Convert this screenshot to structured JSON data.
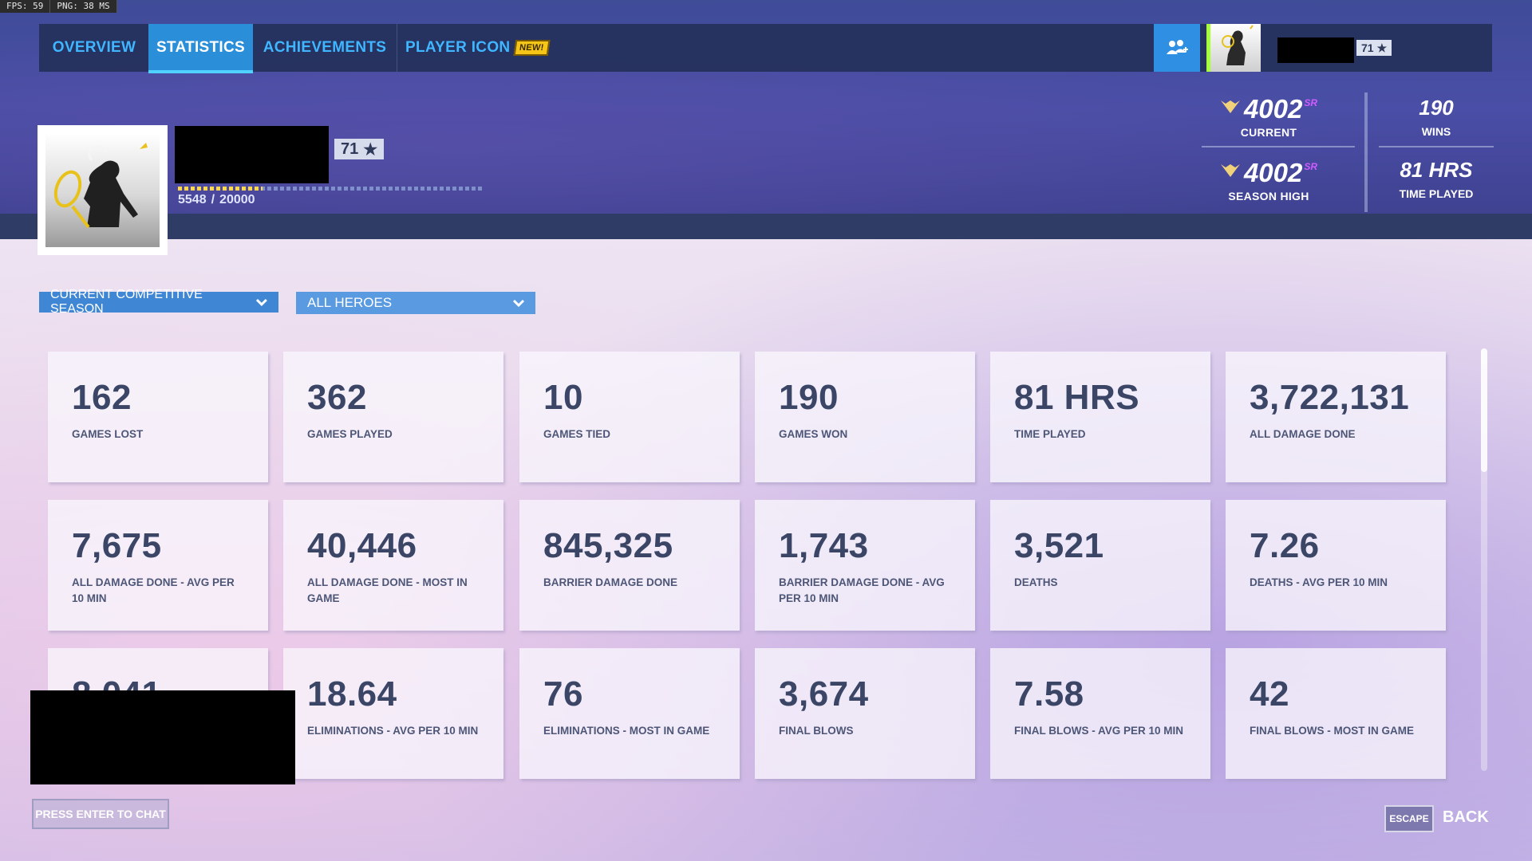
{
  "debug": {
    "fps": "FPS:  59",
    "png": "PNG:  38 MS"
  },
  "nav": {
    "tabs": [
      {
        "label": "OVERVIEW"
      },
      {
        "label": "STATISTICS"
      },
      {
        "label": "ACHIEVEMENTS"
      },
      {
        "label": "PLAYER ICON"
      }
    ],
    "new_badge": "NEW!",
    "player_level": "71"
  },
  "profile": {
    "level": "71",
    "xp_current": "5548",
    "xp_total": "20000",
    "xp_fraction": 0.277
  },
  "rank": {
    "current_sr": "4002",
    "current_label": "CURRENT",
    "season_high_sr": "4002",
    "season_high_label": "SEASON HIGH",
    "sr_suffix": "SR",
    "wins": "190",
    "wins_label": "WINS",
    "time_played": "81 HRS",
    "time_played_label": "TIME PLAYED"
  },
  "filters": {
    "season": "CURRENT COMPETITIVE SEASON",
    "hero": "ALL HEROES"
  },
  "stats": [
    {
      "value": "162",
      "label": "GAMES LOST"
    },
    {
      "value": "362",
      "label": "GAMES PLAYED"
    },
    {
      "value": "10",
      "label": "GAMES TIED"
    },
    {
      "value": "190",
      "label": "GAMES WON"
    },
    {
      "value": "81 HRS",
      "label": "TIME PLAYED"
    },
    {
      "value": "3,722,131",
      "label": "ALL DAMAGE DONE"
    },
    {
      "value": "7,675",
      "label": "ALL DAMAGE DONE - AVG PER 10 MIN"
    },
    {
      "value": "40,446",
      "label": "ALL DAMAGE DONE - MOST IN GAME"
    },
    {
      "value": "845,325",
      "label": "BARRIER DAMAGE DONE"
    },
    {
      "value": "1,743",
      "label": "BARRIER DAMAGE DONE - AVG PER 10 MIN"
    },
    {
      "value": "3,521",
      "label": "DEATHS"
    },
    {
      "value": "7.26",
      "label": "DEATHS - AVG PER 10 MIN"
    },
    {
      "value": "8,041",
      "label": ""
    },
    {
      "value": "18.64",
      "label": "ELIMINATIONS - AVG PER 10 MIN"
    },
    {
      "value": "76",
      "label": "ELIMINATIONS - MOST IN GAME"
    },
    {
      "value": "3,674",
      "label": "FINAL BLOWS"
    },
    {
      "value": "7.58",
      "label": "FINAL BLOWS - AVG PER 10 MIN"
    },
    {
      "value": "42",
      "label": "FINAL BLOWS - MOST IN GAME"
    }
  ],
  "footer": {
    "chat_prompt": "PRESS ENTER TO CHAT",
    "escape_key": "ESCAPE",
    "back_label": "BACK"
  }
}
